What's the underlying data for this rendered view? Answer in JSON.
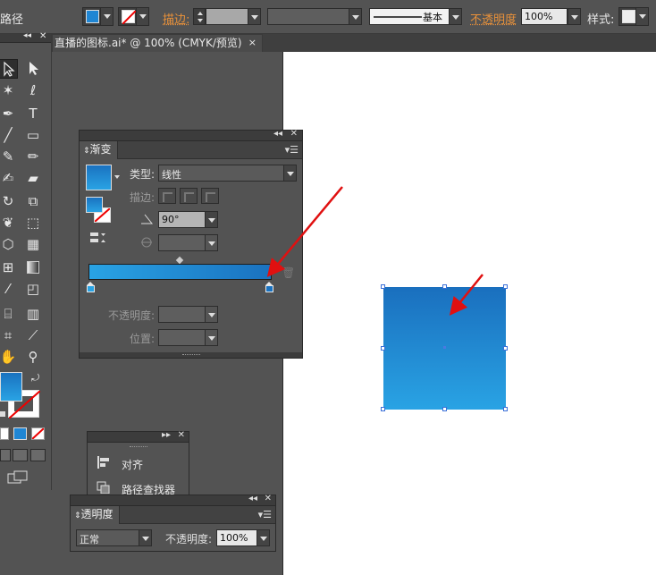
{
  "control_bar": {
    "path_label": "路径",
    "stroke_label": "描边:",
    "line_style_label": "基本",
    "opacity_label": "不透明度",
    "opacity_value": "100%",
    "style_label": "样式:"
  },
  "document_tab": {
    "title": "直播的图标.ai* @ 100% (CMYK/预览)",
    "close": "×"
  },
  "gradient_panel": {
    "tab_label": "渐变",
    "type_label": "类型:",
    "type_value": "线性",
    "stroke_label": "描边:",
    "angle_value": "90°",
    "opacity_label": "不透明度:",
    "position_label": "位置:"
  },
  "align_panel": {
    "items": [
      "对齐",
      "路径查找器"
    ]
  },
  "transparency_panel": {
    "tab_label": "透明度",
    "blend_mode": "正常",
    "opacity_label": "不透明度:",
    "opacity_value": "100%"
  },
  "colors": {
    "gradient_start": "#29a3e4",
    "gradient_end": "#1a72c0",
    "arrow": "#e01010"
  }
}
